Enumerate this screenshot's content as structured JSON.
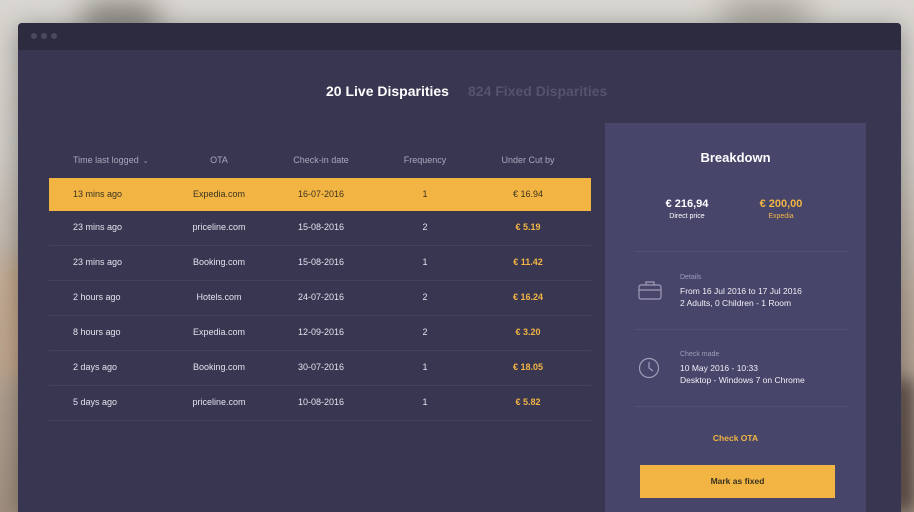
{
  "tabs": {
    "live": "20 Live Disparities",
    "fixed": "824 Fixed Disparities"
  },
  "table": {
    "headers": [
      "Time last logged",
      "OTA",
      "Check-in date",
      "Frequency",
      "Under Cut by"
    ],
    "rows": [
      {
        "time": "13 mins ago",
        "ota": "Expedia.com",
        "checkin": "16-07-2016",
        "frequency": "1",
        "under": "€ 16.94"
      },
      {
        "time": "23 mins ago",
        "ota": "priceline.com",
        "checkin": "15-08-2016",
        "frequency": "2",
        "under": "€ 5.19"
      },
      {
        "time": "23 mins ago",
        "ota": "Booking.com",
        "checkin": "15-08-2016",
        "frequency": "1",
        "under": "€ 11.42"
      },
      {
        "time": "2 hours ago",
        "ota": "Hotels.com",
        "checkin": "24-07-2016",
        "frequency": "2",
        "under": "€ 16.24"
      },
      {
        "time": "8 hours ago",
        "ota": "Expedia.com",
        "checkin": "12-09-2016",
        "frequency": "2",
        "under": "€ 3.20"
      },
      {
        "time": "2 days ago",
        "ota": "Booking.com",
        "checkin": "30-07-2016",
        "frequency": "1",
        "under": "€ 18.05"
      },
      {
        "time": "5 days ago",
        "ota": "priceline.com",
        "checkin": "10-08-2016",
        "frequency": "1",
        "under": "€ 5.82"
      }
    ]
  },
  "breakdown": {
    "title": "Breakdown",
    "direct_price": "€ 216,94",
    "direct_label": "Direct price",
    "ota_price": "€ 200,00",
    "ota_label": "Expedia",
    "details_label": "Details",
    "details_line1": "From 16 Jul 2016 to 17 Jul 2016",
    "details_line2": "2 Adults, 0 Children - 1 Room",
    "check_label": "Check made",
    "check_line1": "10 May 2016 - 10:33",
    "check_line2": "Desktop - Windows 7 on Chrome",
    "check_ota": "Check OTA",
    "mark_fixed": "Mark as fixed"
  },
  "icons": {
    "sort": "chevron-down-icon",
    "details": "briefcase-icon",
    "check": "clock-icon"
  },
  "colors": {
    "accent": "#f2b544",
    "window_bg": "#383650",
    "panel_bg": "#47456a"
  }
}
